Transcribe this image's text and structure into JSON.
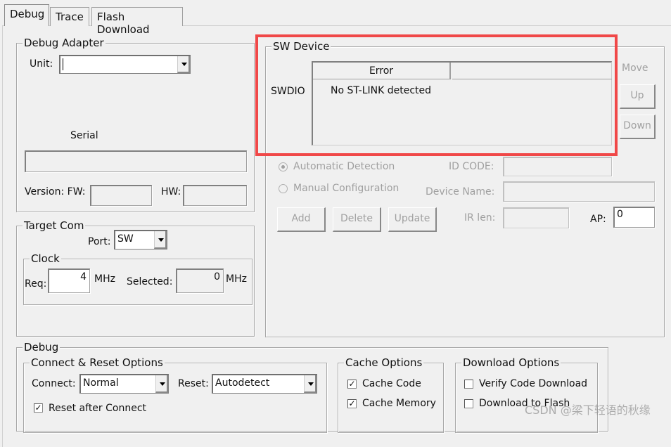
{
  "tabs": [
    "Debug",
    "Trace",
    "Flash Download"
  ],
  "debug_adapter": {
    "title": "Debug Adapter",
    "unit_label": "Unit:",
    "unit_value": "",
    "serial_label": "Serial",
    "serial_value": "",
    "version_label": "Version: FW:",
    "fw_value": "",
    "hw_label": "HW:",
    "hw_value": ""
  },
  "sw_device": {
    "title": "SW Device",
    "row_label": "SWDIO",
    "columns": [
      "Error",
      ""
    ],
    "row_value": "No ST-LINK detected",
    "move_label": "Move",
    "up": "Up",
    "down": "Down",
    "auto_detection": "Automatic Detection",
    "manual_config": "Manual Configuration",
    "auto_selected": true,
    "id_code_label": "ID CODE:",
    "device_name_label": "Device Name:",
    "add": "Add",
    "delete": "Delete",
    "update": "Update",
    "ir_len_label": "IR len:",
    "ap_label": "AP:",
    "ap_value": "0",
    "highlight_color": "#f04848"
  },
  "target_com": {
    "title": "Target Com",
    "port_label": "Port:",
    "port_value": "SW",
    "clock_title": "Clock",
    "req_label": "Req:",
    "req_value": "4",
    "mhz": "MHz",
    "selected_label": "Selected:",
    "selected_value": "0"
  },
  "debug": {
    "title": "Debug",
    "connect_reset": {
      "title": "Connect & Reset Options",
      "connect_label": "Connect:",
      "connect_value": "Normal",
      "reset_label": "Reset:",
      "reset_value": "Autodetect",
      "reset_after_connect": "Reset after Connect",
      "reset_after_connect_checked": true
    },
    "cache": {
      "title": "Cache Options",
      "cache_code": "Cache Code",
      "cache_code_checked": true,
      "cache_memory": "Cache Memory",
      "cache_memory_checked": true
    },
    "download": {
      "title": "Download Options",
      "verify": "Verify Code Download",
      "verify_checked": false,
      "flash": "Download to Flash",
      "flash_checked": false
    }
  },
  "watermark": "CSDN @梁下轻语的秋缘"
}
